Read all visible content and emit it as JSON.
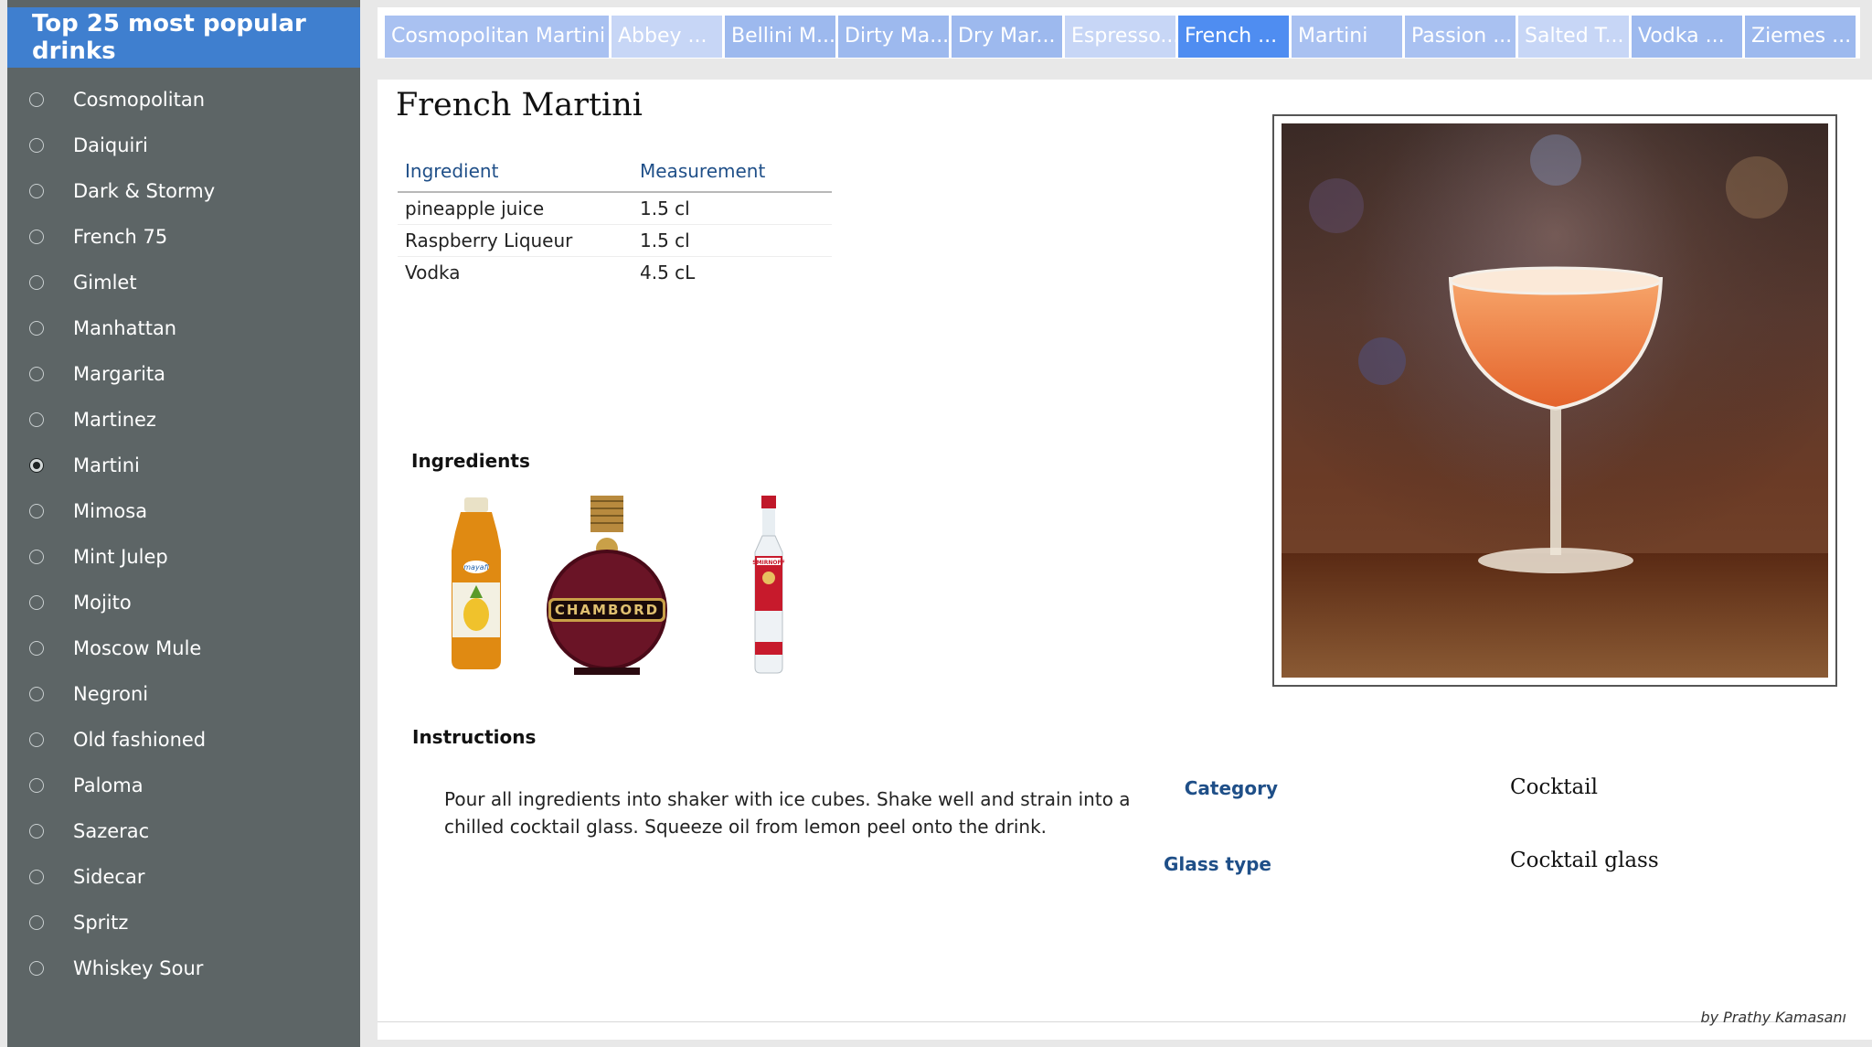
{
  "sidebar": {
    "title": "Top 25 most popular drinks",
    "items": [
      {
        "label": "Cosmopolitan",
        "selected": false
      },
      {
        "label": "Daiquiri",
        "selected": false
      },
      {
        "label": "Dark & Stormy",
        "selected": false
      },
      {
        "label": "French 75",
        "selected": false
      },
      {
        "label": "Gimlet",
        "selected": false
      },
      {
        "label": "Manhattan",
        "selected": false
      },
      {
        "label": "Margarita",
        "selected": false
      },
      {
        "label": "Martinez",
        "selected": false
      },
      {
        "label": "Martini",
        "selected": true
      },
      {
        "label": "Mimosa",
        "selected": false
      },
      {
        "label": "Mint Julep",
        "selected": false
      },
      {
        "label": "Mojito",
        "selected": false
      },
      {
        "label": "Moscow Mule",
        "selected": false
      },
      {
        "label": "Negroni",
        "selected": false
      },
      {
        "label": "Old fashioned",
        "selected": false
      },
      {
        "label": "Paloma",
        "selected": false
      },
      {
        "label": "Sazerac",
        "selected": false
      },
      {
        "label": "Sidecar",
        "selected": false
      },
      {
        "label": "Spritz",
        "selected": false
      },
      {
        "label": "Whiskey Sour",
        "selected": false
      }
    ]
  },
  "tabs": [
    {
      "label": "Cosmopolitan Martini"
    },
    {
      "label": "Abbey ..."
    },
    {
      "label": "Bellini M..."
    },
    {
      "label": "Dirty Ma..."
    },
    {
      "label": "Dry Mar..."
    },
    {
      "label": "Espresso..."
    },
    {
      "label": "French ..."
    },
    {
      "label": "Martini"
    },
    {
      "label": "Passion ..."
    },
    {
      "label": "Salted T..."
    },
    {
      "label": "Vodka ..."
    },
    {
      "label": "Ziemes ..."
    }
  ],
  "drink": {
    "title": "French Martini",
    "table": {
      "headers": [
        "Ingredient",
        "Measurement"
      ],
      "rows": [
        [
          "pineapple juice",
          "1.5 cl"
        ],
        [
          "Raspberry Liqueur",
          "1.5 cl"
        ],
        [
          "Vodka",
          "4.5 cL"
        ]
      ]
    },
    "ingredients_label": "Ingredients",
    "bottles": [
      {
        "icon": "pineapple-juice-bottle-icon",
        "brand": "mayafi"
      },
      {
        "icon": "chambord-bottle-icon",
        "brand": "CHAMBORD"
      },
      {
        "icon": "smirnoff-bottle-icon",
        "brand": "SMIRNOFF"
      }
    ],
    "instructions_label": "Instructions",
    "instructions": "Pour all ingredients into shaker with ice cubes. Shake well and strain into a chilled cocktail glass. Squeeze oil from lemon peel onto the drink.",
    "category_label": "Category",
    "category": "Cocktail",
    "glass_label": "Glass type",
    "glass": "Cocktail glass"
  },
  "credit": "by Prathy Kamasanı",
  "colors": {
    "sidebar_bg": "#5d6566",
    "sidebar_title_bg": "#3f7fcf",
    "tab_active": "#4f8df1",
    "tab_inactive": "#9db9ee",
    "label_blue": "#1f4f88"
  }
}
